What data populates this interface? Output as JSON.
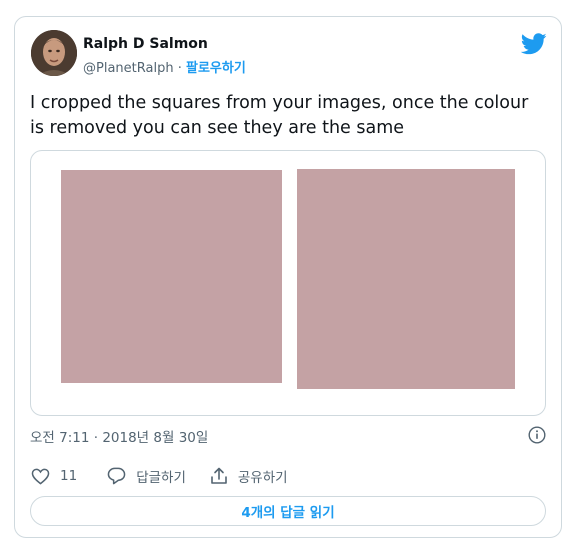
{
  "author": {
    "name": "Ralph D Salmon",
    "handle": "@PlanetRalph",
    "separator": " · ",
    "follow_label": "팔로우하기"
  },
  "tweet": {
    "text": "I cropped the squares from your images, once the colour is removed you can see they are the same"
  },
  "media": {
    "swatch_colors": [
      "#c4a2a5",
      "#c4a2a4"
    ]
  },
  "timestamp": "오전 7:11 · 2018년 8월 30일",
  "actions": {
    "like_count": "11",
    "reply_label": "답글하기",
    "share_label": "공유하기"
  },
  "read_replies_label": "4개의 답글 읽기",
  "icons": [
    "avatar",
    "twitter-bird-icon",
    "info-icon",
    "heart-icon",
    "reply-icon",
    "share-icon"
  ],
  "colors": {
    "accent": "#1d9bf0",
    "secondary_text": "#536471",
    "border": "#cfd9de"
  }
}
